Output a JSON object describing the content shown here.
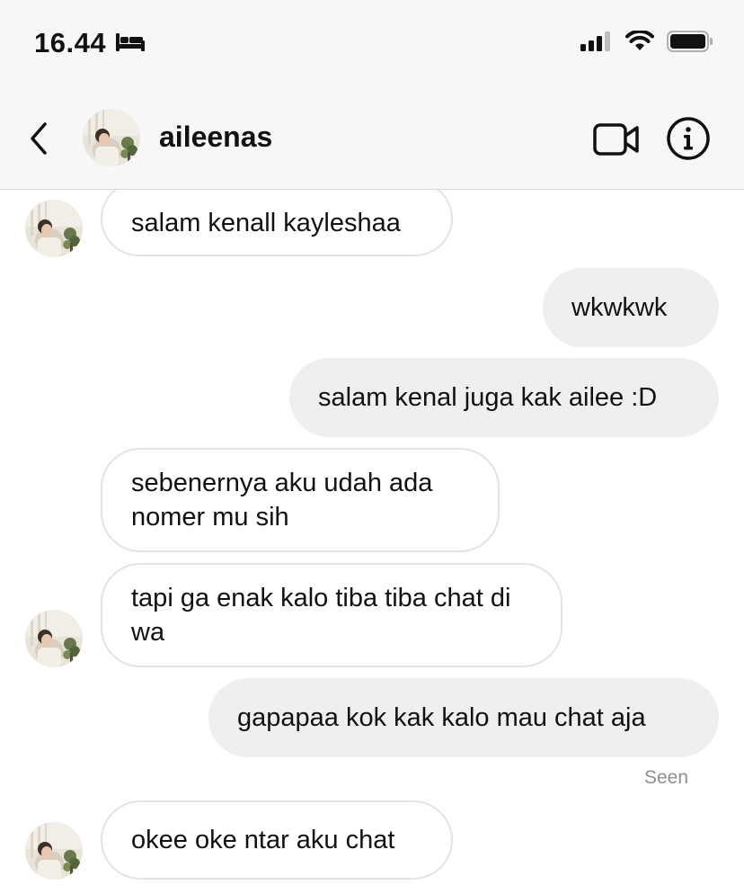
{
  "status_bar": {
    "time": "16.44"
  },
  "header": {
    "username": "aileenas"
  },
  "messages": [
    {
      "side": "in",
      "text": "salam kenall kayleshaa"
    },
    {
      "side": "out",
      "text": "wkwkwk"
    },
    {
      "side": "out",
      "text": "salam kenal juga kak ailee :D"
    },
    {
      "side": "in",
      "text": "sebenernya aku udah ada nomer mu sih"
    },
    {
      "side": "in",
      "text": "tapi ga enak kalo tiba tiba chat di wa"
    },
    {
      "side": "out",
      "text": "gapapaa kok kak kalo mau chat aja"
    },
    {
      "side": "in",
      "text": "okee oke ntar aku chat"
    }
  ],
  "seen_label": "Seen",
  "colors": {
    "outgoing_bubble": "#efefef",
    "incoming_border": "#e3e3e3",
    "header_bg": "#f7f7f7"
  }
}
